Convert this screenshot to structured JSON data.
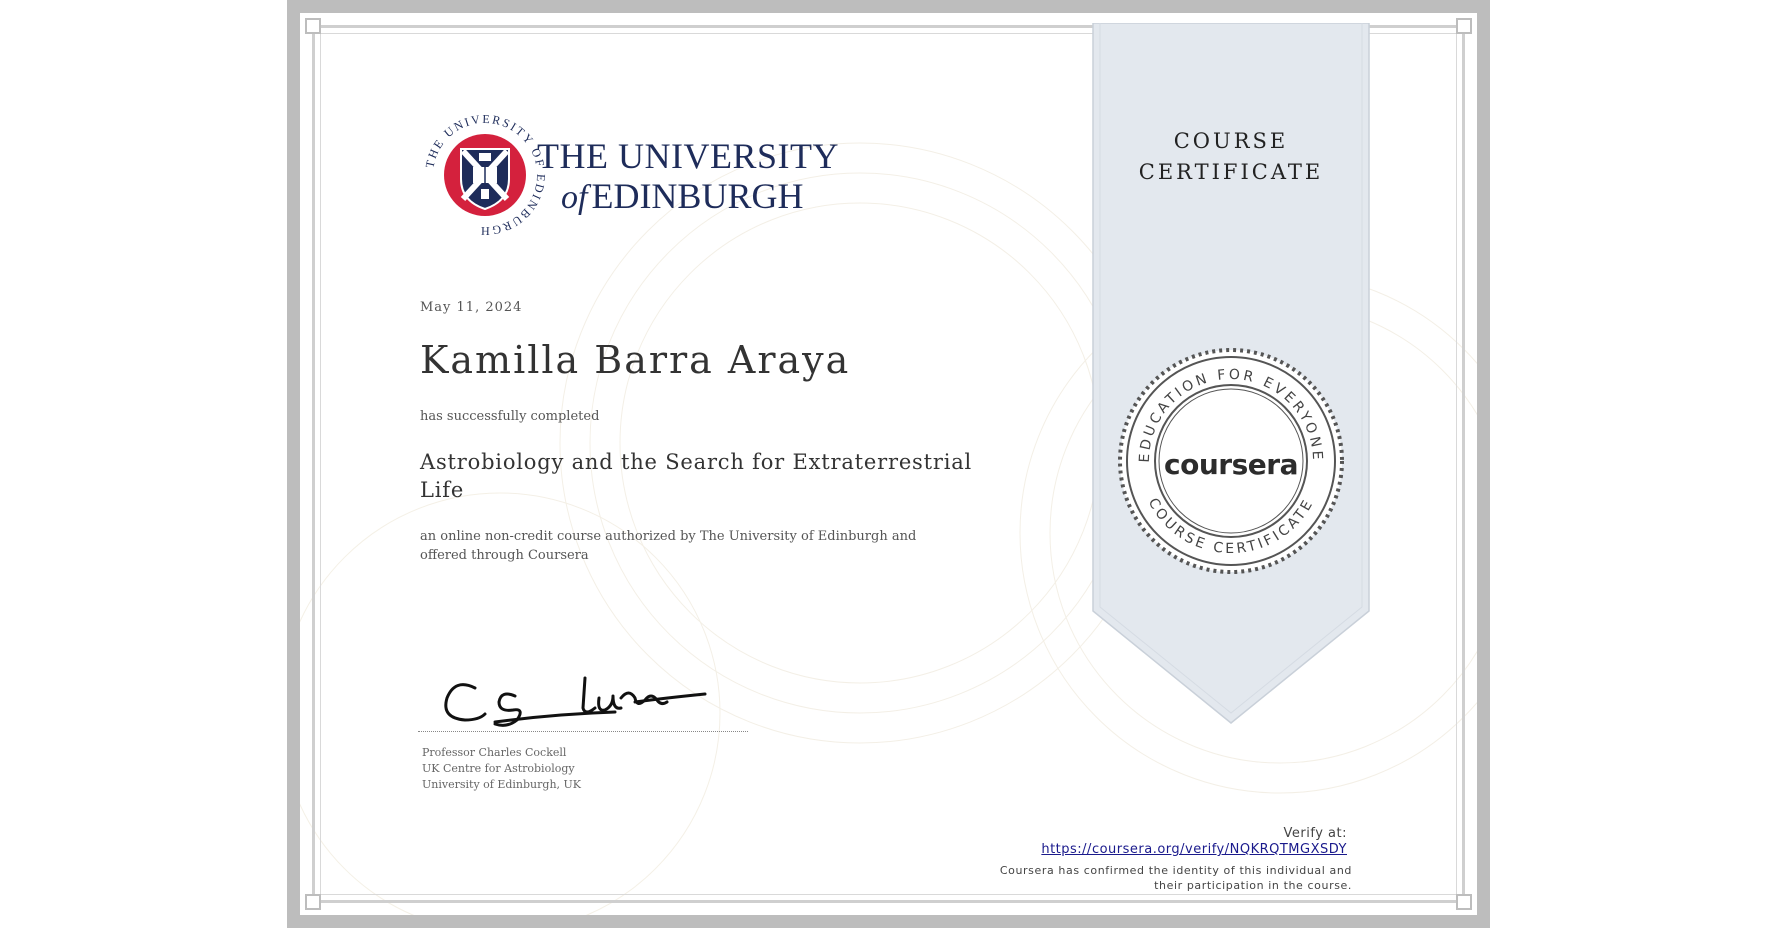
{
  "university": {
    "name_line1": "THE UNIVERSITY",
    "name_of": "of",
    "name_line2": "EDINBURGH",
    "seal_text": "THE UNIVERSITY OF EDINBURGH"
  },
  "certificate": {
    "date": "May 11, 2024",
    "recipient": "Kamilla Barra Araya",
    "completed_text": "has successfully completed",
    "course_title": "Astrobiology and the Search for Extraterrestrial Life",
    "description": "an online non-credit course authorized by The University of Edinburgh and offered through Coursera"
  },
  "signer": {
    "name": "Professor Charles Cockell",
    "department": "UK Centre for Astrobiology",
    "institution": "University of Edinburgh, UK"
  },
  "ribbon": {
    "line1": "COURSE",
    "line2": "CERTIFICATE"
  },
  "seal": {
    "wordmark": "coursera",
    "top_arc": "EDUCATION FOR EVERYONE",
    "bottom_arc": "COURSE CERTIFICATE"
  },
  "verify": {
    "label": "Verify at:",
    "url": "https://coursera.org/verify/NQKRQTMGXSDY",
    "note": "Coursera has confirmed the identity of this individual and their participation in the course."
  },
  "colors": {
    "frame": "#bdbdbd",
    "ribbon": "#e3e8ee",
    "university_blue": "#1e2c5a",
    "university_red": "#d4213d",
    "link": "#1a1a8c"
  }
}
